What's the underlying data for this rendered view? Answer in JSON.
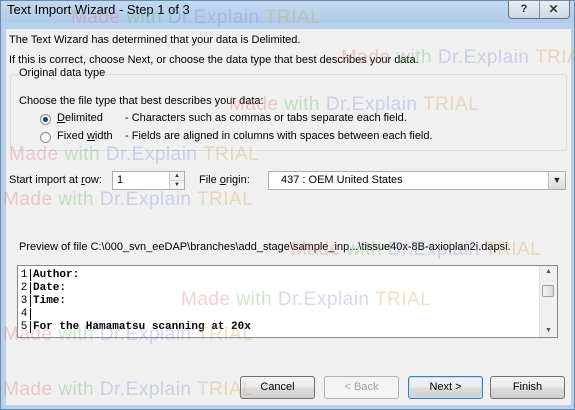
{
  "window": {
    "title": "Text Import Wizard - Step 1 of 3",
    "help_label": "?",
    "close_label": "X"
  },
  "intro": {
    "line1": "The Text Wizard has determined that your data is Delimited.",
    "line2": "If this is correct, choose Next, or choose the data type that best describes your data."
  },
  "data_type": {
    "legend": "Original data type",
    "prompt": "Choose the file type that best describes your data:",
    "options": [
      {
        "label_pre": "",
        "label_key": "D",
        "label_post": "elimited",
        "description": "- Characters such as commas or tabs separate each field.",
        "checked": true
      },
      {
        "label_pre": "Fixed ",
        "label_key": "w",
        "label_post": "idth",
        "description": "- Fields are aligned in columns with spaces between each field.",
        "checked": false
      }
    ]
  },
  "start_row": {
    "label_pre": "Start import at ",
    "label_key": "r",
    "label_post": "ow:",
    "value": "1"
  },
  "file_origin": {
    "label_pre": "File ",
    "label_key": "o",
    "label_post": "rigin:",
    "value": "437 : OEM United States"
  },
  "preview": {
    "label": "Preview of file C:\\000_svn_eeDAP\\branches\\add_stage\\sample_inp...\\tissue40x-8B-axioplan2i.dapsi.",
    "rows": [
      {
        "num": "1",
        "text": "Author:"
      },
      {
        "num": "2",
        "text": "Date:"
      },
      {
        "num": "3",
        "text": "Time:"
      },
      {
        "num": "4",
        "text": ""
      },
      {
        "num": "5",
        "text": "For the Hamamatsu scanning at 20x"
      }
    ]
  },
  "buttons": {
    "cancel": "Cancel",
    "back": "< Back",
    "next": "Next >",
    "finish": "Finish"
  },
  "watermark": {
    "made": "Made",
    "with": "with",
    "brand": "Dr.Explain",
    "trial": "TRIAL"
  }
}
